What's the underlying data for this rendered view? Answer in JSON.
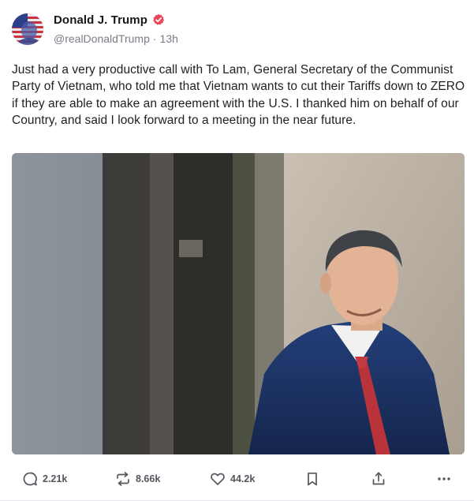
{
  "colors": {
    "verified_badge": "#e9475a",
    "text_primary": "#1f1f24",
    "text_secondary": "#7b7b86",
    "icon": "#55555f"
  },
  "author": {
    "display_name": "Donald J. Trump",
    "handle": "@realDonaldTrump",
    "separator": "·",
    "timestamp": "13h",
    "verified": true,
    "avatar_icon": "flag-portrait-avatar"
  },
  "post": {
    "text": "Just had a very productive call with To Lam, General Secretary of the Communist Party of Vietnam, who told me that Vietnam wants to cut their Tariffs down to ZERO if they are able to make an agreement with the U.S. I thanked him on behalf of our Country, and said I look forward to a meeting in the near future."
  },
  "media": {
    "description_icon": "photo-man-in-navy-suit-red-tie"
  },
  "actions": {
    "replies": {
      "icon": "reply-icon",
      "count": "2.21k"
    },
    "retruths": {
      "icon": "retruth-icon",
      "count": "8.66k"
    },
    "likes": {
      "icon": "heart-icon",
      "count": "44.2k"
    },
    "bookmark": {
      "icon": "bookmark-icon"
    },
    "share": {
      "icon": "share-icon"
    },
    "more": {
      "icon": "more-icon"
    }
  }
}
